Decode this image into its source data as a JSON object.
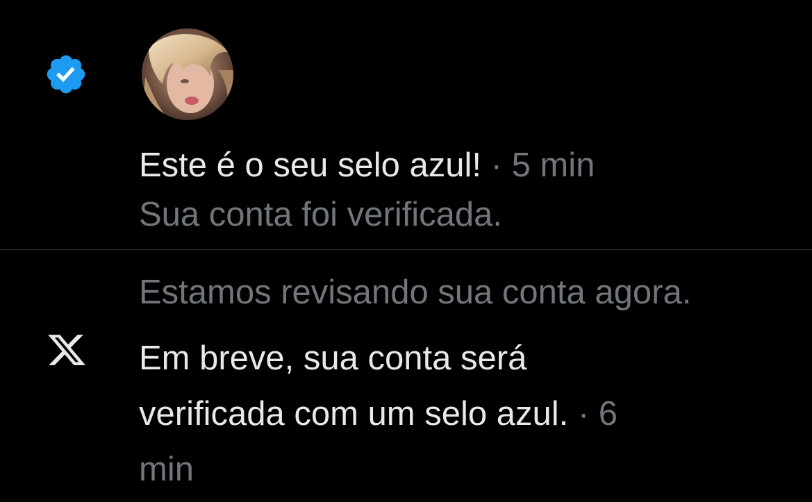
{
  "notifications": [
    {
      "icon": "verified-badge-icon",
      "avatar": "user-avatar",
      "title": "Este é o seu selo azul!",
      "separator": " · ",
      "time": "5 min",
      "subtitle": "Sua conta foi verificada."
    },
    {
      "icon": "x-logo-icon",
      "heading": "Estamos revisando sua conta agora.",
      "body_line1": "Em breve, sua conta será",
      "body_line2": "verificada com um selo azul.",
      "separator": " · ",
      "time_part1": "6",
      "time_part2": "min"
    }
  ],
  "colors": {
    "background": "#000000",
    "text_primary": "#e7e9ea",
    "text_muted": "#71767b",
    "verified_blue": "#1d9bf0",
    "divider": "#2f3336"
  }
}
